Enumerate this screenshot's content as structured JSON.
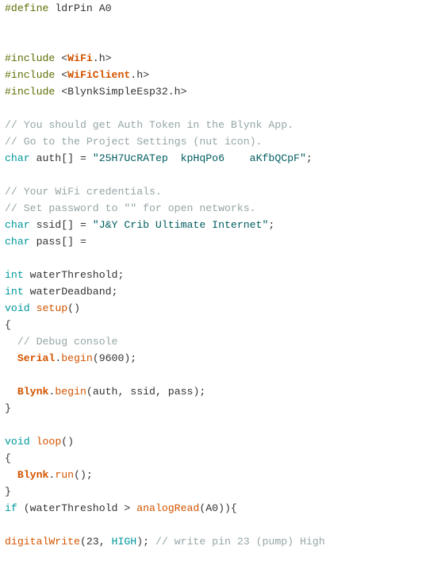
{
  "editor": {
    "colors": {
      "directive": "#5e6d03",
      "comment": "#95a5a6",
      "string": "#005c5f",
      "type": "#00979c",
      "function": "#d35400",
      "plain": "#333333",
      "background": "#ffffff"
    },
    "lines": [
      {
        "tokens": [
          {
            "k": "directive",
            "t": "#define"
          },
          {
            "k": "plain",
            "t": " ldrPin A0"
          }
        ]
      },
      {
        "tokens": []
      },
      {
        "tokens": []
      },
      {
        "tokens": [
          {
            "k": "directive",
            "t": "#include"
          },
          {
            "k": "plain",
            "t": " <"
          },
          {
            "k": "class",
            "t": "WiFi"
          },
          {
            "k": "plain",
            "t": ".h>"
          }
        ]
      },
      {
        "tokens": [
          {
            "k": "directive",
            "t": "#include"
          },
          {
            "k": "plain",
            "t": " <"
          },
          {
            "k": "class",
            "t": "WiFiClient"
          },
          {
            "k": "plain",
            "t": ".h>"
          }
        ]
      },
      {
        "tokens": [
          {
            "k": "directive",
            "t": "#include"
          },
          {
            "k": "plain",
            "t": " <BlynkSimpleEsp32.h>"
          }
        ]
      },
      {
        "tokens": []
      },
      {
        "tokens": [
          {
            "k": "comment",
            "t": "// You should get Auth Token in the Blynk App."
          }
        ]
      },
      {
        "tokens": [
          {
            "k": "comment",
            "t": "// Go to the Project Settings (nut icon)."
          }
        ]
      },
      {
        "tokens": [
          {
            "k": "type",
            "t": "char"
          },
          {
            "k": "plain",
            "t": " auth[] = "
          },
          {
            "k": "string",
            "t": "\"25H7"
          },
          {
            "k": "string",
            "t": "UcRATep"
          },
          {
            "k": "string",
            "t": "  kpHqPo6    aKfbQCpF\""
          },
          {
            "k": "plain",
            "t": ";"
          }
        ]
      },
      {
        "tokens": []
      },
      {
        "tokens": [
          {
            "k": "comment",
            "t": "// Your WiFi credentials."
          }
        ]
      },
      {
        "tokens": [
          {
            "k": "comment",
            "t": "// Set password to \"\" for open networks."
          }
        ]
      },
      {
        "tokens": [
          {
            "k": "type",
            "t": "char"
          },
          {
            "k": "plain",
            "t": " ssid[] = "
          },
          {
            "k": "string",
            "t": "\"J&Y Crib Ultimate Internet\""
          },
          {
            "k": "plain",
            "t": ";"
          }
        ]
      },
      {
        "tokens": [
          {
            "k": "type",
            "t": "char"
          },
          {
            "k": "plain",
            "t": " pass[] = "
          }
        ]
      },
      {
        "tokens": []
      },
      {
        "tokens": [
          {
            "k": "type",
            "t": "int"
          },
          {
            "k": "plain",
            "t": " waterThreshold;"
          }
        ]
      },
      {
        "tokens": [
          {
            "k": "type",
            "t": "int"
          },
          {
            "k": "plain",
            "t": " waterDeadband;"
          }
        ]
      },
      {
        "tokens": [
          {
            "k": "type",
            "t": "void"
          },
          {
            "k": "plain",
            "t": " "
          },
          {
            "k": "function",
            "t": "setup"
          },
          {
            "k": "plain",
            "t": "()"
          }
        ]
      },
      {
        "tokens": [
          {
            "k": "plain",
            "t": "{"
          }
        ]
      },
      {
        "tokens": [
          {
            "k": "plain",
            "t": "  "
          },
          {
            "k": "comment",
            "t": "// Debug console"
          }
        ]
      },
      {
        "tokens": [
          {
            "k": "plain",
            "t": "  "
          },
          {
            "k": "class",
            "t": "Serial"
          },
          {
            "k": "plain",
            "t": "."
          },
          {
            "k": "function",
            "t": "begin"
          },
          {
            "k": "plain",
            "t": "(9600);"
          }
        ]
      },
      {
        "tokens": []
      },
      {
        "tokens": [
          {
            "k": "plain",
            "t": "  "
          },
          {
            "k": "class",
            "t": "Blynk"
          },
          {
            "k": "plain",
            "t": "."
          },
          {
            "k": "function",
            "t": "begin"
          },
          {
            "k": "plain",
            "t": "(auth, ssid, pass);"
          }
        ]
      },
      {
        "tokens": [
          {
            "k": "plain",
            "t": "}"
          }
        ]
      },
      {
        "tokens": []
      },
      {
        "tokens": [
          {
            "k": "type",
            "t": "void"
          },
          {
            "k": "plain",
            "t": " "
          },
          {
            "k": "function",
            "t": "loop"
          },
          {
            "k": "plain",
            "t": "()"
          }
        ]
      },
      {
        "tokens": [
          {
            "k": "plain",
            "t": "{"
          }
        ]
      },
      {
        "tokens": [
          {
            "k": "plain",
            "t": "  "
          },
          {
            "k": "class",
            "t": "Blynk"
          },
          {
            "k": "plain",
            "t": "."
          },
          {
            "k": "function",
            "t": "run"
          },
          {
            "k": "plain",
            "t": "();"
          }
        ]
      },
      {
        "tokens": [
          {
            "k": "plain",
            "t": "}"
          }
        ]
      },
      {
        "tokens": [
          {
            "k": "type",
            "t": "if"
          },
          {
            "k": "plain",
            "t": " (waterThreshold > "
          },
          {
            "k": "function",
            "t": "analogRead"
          },
          {
            "k": "plain",
            "t": "(A0)){"
          }
        ]
      },
      {
        "tokens": []
      },
      {
        "tokens": [
          {
            "k": "function",
            "t": "digitalWrite"
          },
          {
            "k": "plain",
            "t": "(23, "
          },
          {
            "k": "const",
            "t": "HIGH"
          },
          {
            "k": "plain",
            "t": "); "
          },
          {
            "k": "comment",
            "t": "// write pin 23 (pump) High"
          }
        ]
      }
    ]
  }
}
